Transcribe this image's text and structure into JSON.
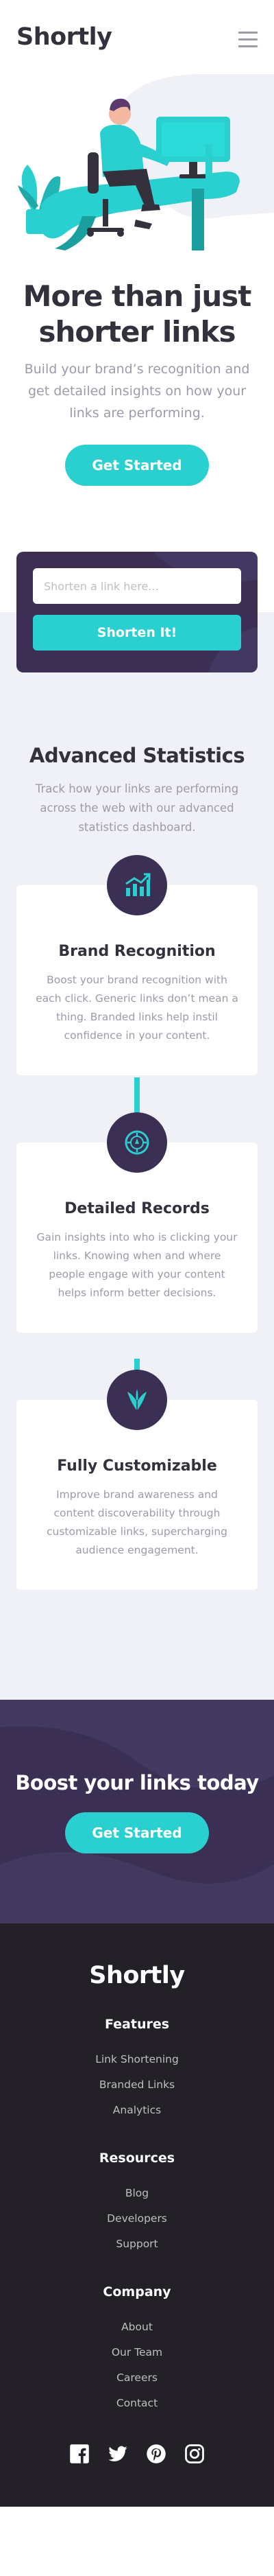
{
  "header": {
    "logo": "Shortly",
    "menu_icon": "hamburger-menu-icon"
  },
  "hero": {
    "illustration": "person-working-at-desk-illustration",
    "title": "More than just shorter links",
    "subtitle": "Build your brand’s recognition and get detailed insights on how your links are performing.",
    "cta": "Get Started"
  },
  "shorten": {
    "placeholder": "Shorten a link here...",
    "button": "Shorten It!"
  },
  "stats": {
    "title": "Advanced Statistics",
    "subtitle": "Track how your links are performing across the web with our advanced statistics dashboard.",
    "features": [
      {
        "icon": "brand-recognition-icon",
        "title": "Brand Recognition",
        "text": "Boost your brand recognition with each click. Generic links don’t mean a thing. Branded links help instil confidence in your content."
      },
      {
        "icon": "detailed-records-icon",
        "title": "Detailed Records",
        "text": "Gain insights into who is clicking your links. Knowing when and where people engage with your content helps inform better decisions."
      },
      {
        "icon": "fully-customizable-icon",
        "title": "Fully Customizable",
        "text": "Improve brand awareness and content discoverability through customizable links, supercharging audience engagement."
      }
    ]
  },
  "boost": {
    "title": "Boost your links today",
    "cta": "Get Started"
  },
  "footer": {
    "logo": "Shortly",
    "columns": [
      {
        "title": "Features",
        "links": [
          "Link Shortening",
          "Branded Links",
          "Analytics"
        ]
      },
      {
        "title": "Resources",
        "links": [
          "Blog",
          "Developers",
          "Support"
        ]
      },
      {
        "title": "Company",
        "links": [
          "About",
          "Our Team",
          "Careers",
          "Contact"
        ]
      }
    ],
    "socials": [
      "facebook-icon",
      "twitter-icon",
      "pinterest-icon",
      "instagram-icon"
    ]
  },
  "colors": {
    "cyan": "#2acfcf",
    "dark_violet": "#3b3054",
    "very_dark_violet": "#232127",
    "gray": "#9e9aa7",
    "light_gray_bg": "#eff1f7"
  }
}
